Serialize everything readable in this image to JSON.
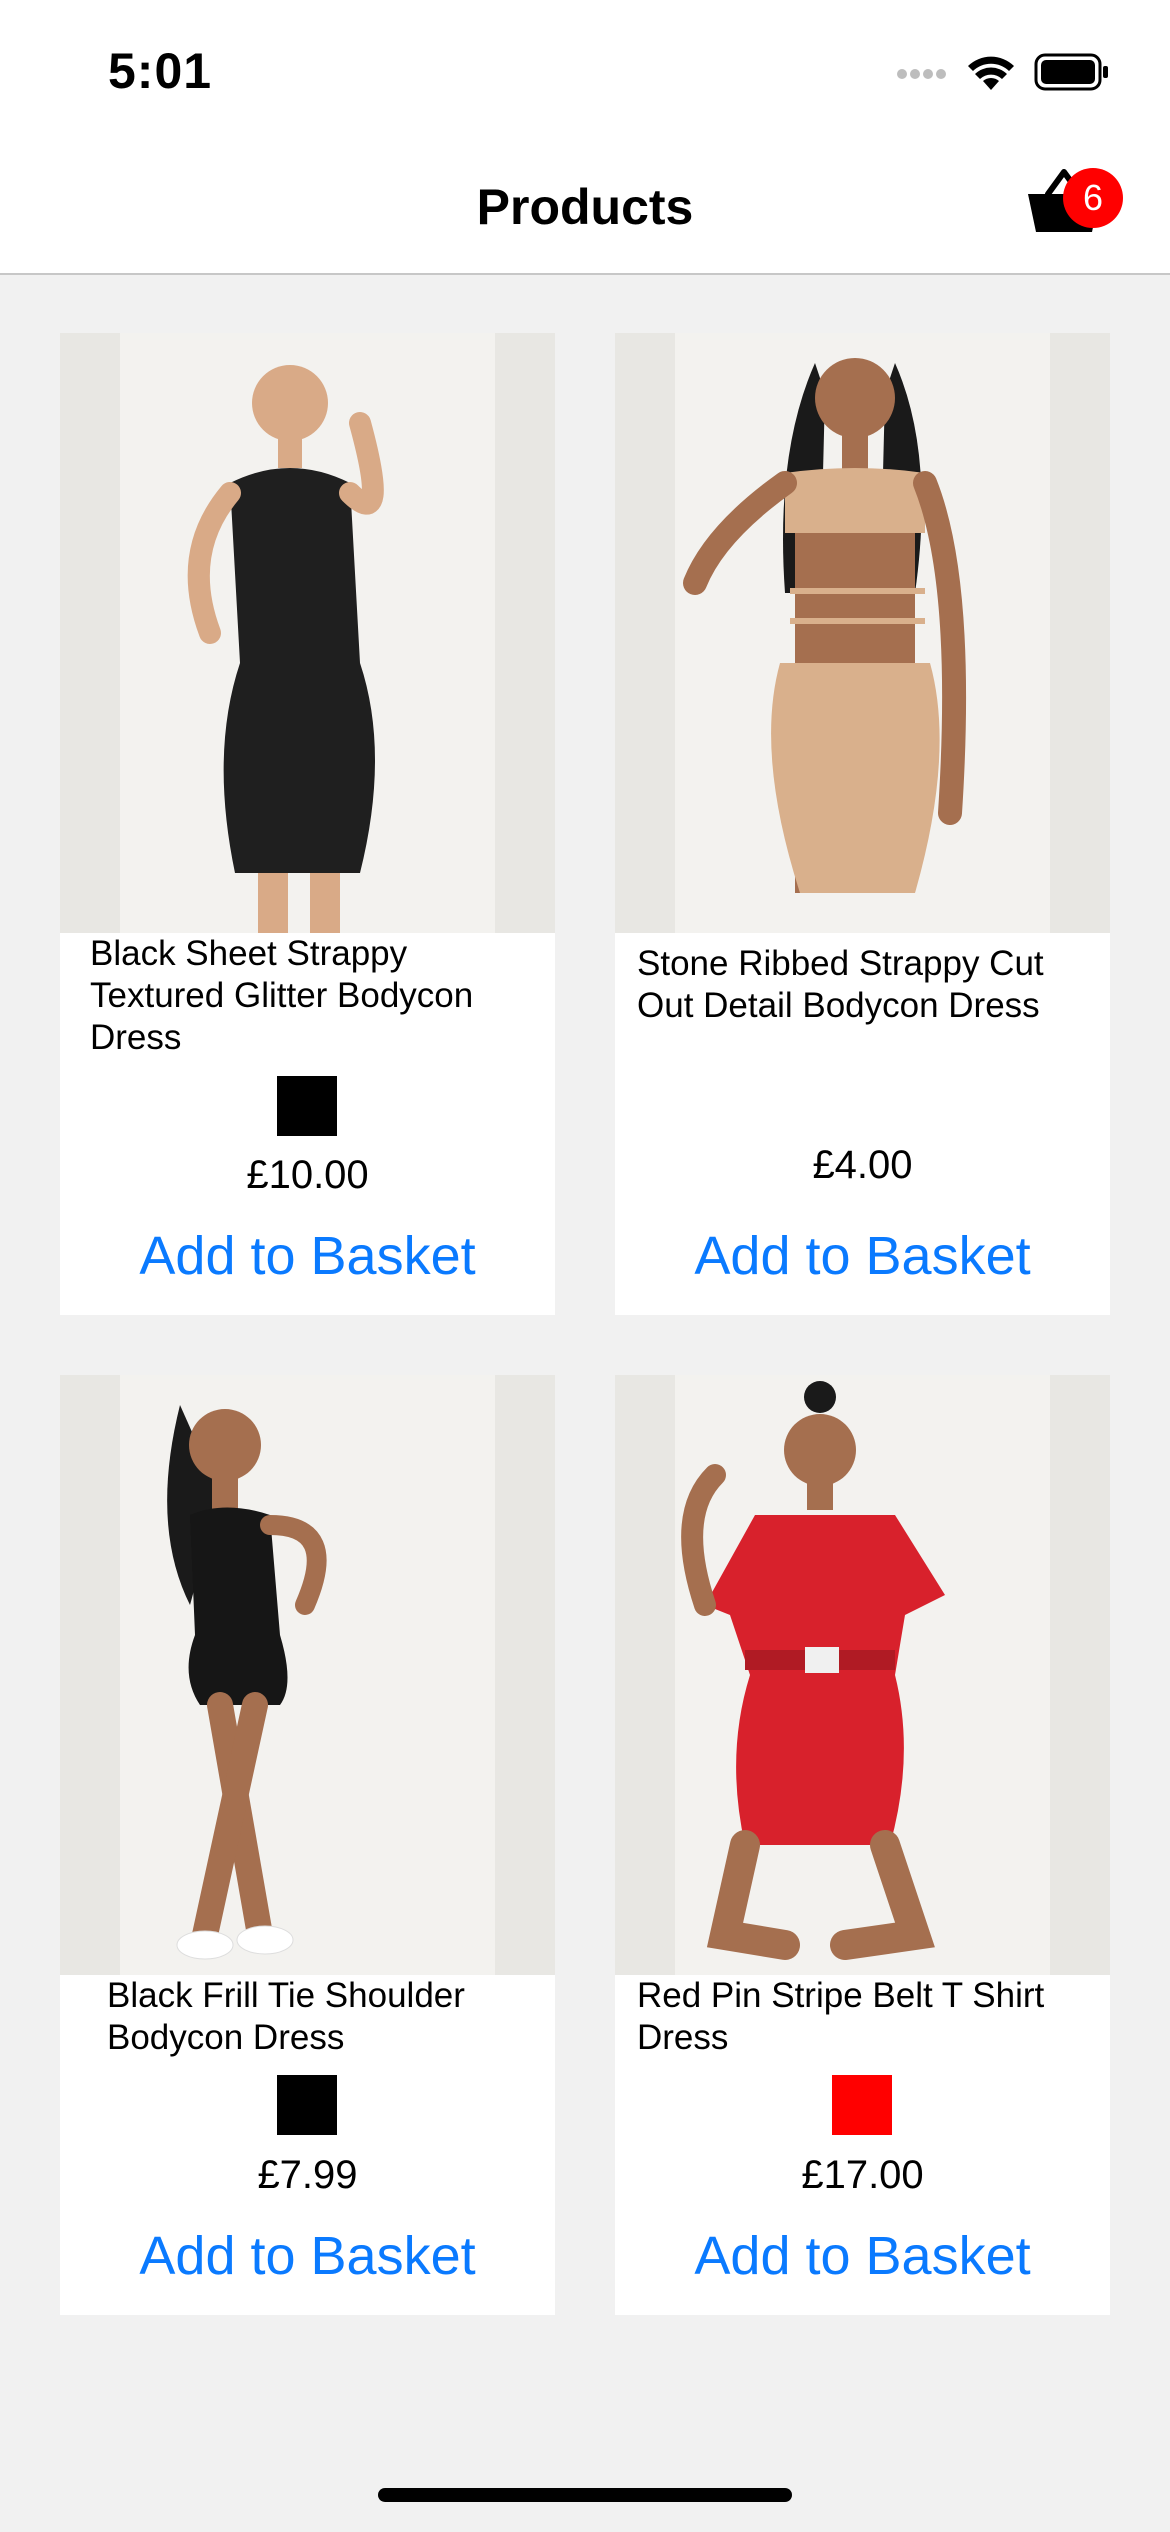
{
  "status_bar": {
    "time": "5:01"
  },
  "nav": {
    "title": "Products",
    "basket_count": "6",
    "basket_icon": "shopping-basket-icon"
  },
  "products": [
    {
      "title": "Black Sheet Strappy Textured Glitter Bodycon Dress",
      "price": "£10.00",
      "swatch_color": "#000000",
      "dress_color": "#1f1f1f",
      "add_label": "Add to Basket"
    },
    {
      "title": "Stone Ribbed Strappy Cut Out Detail Bodycon Dress",
      "price": "£4.00",
      "swatch_color": null,
      "dress_color": "#d9b08c",
      "add_label": "Add to Basket"
    },
    {
      "title": "Black Frill Tie Shoulder Bodycon Dress",
      "price": "£7.99",
      "swatch_color": "#000000",
      "dress_color": "#161616",
      "add_label": "Add to Basket"
    },
    {
      "title": "Red Pin Stripe Belt T Shirt Dress",
      "price": "£17.00",
      "swatch_color": "#ff0000",
      "dress_color": "#d8212c",
      "add_label": "Add to Basket"
    }
  ],
  "colors": {
    "accent": "#0a7aff",
    "badge": "#ff0000",
    "background": "#f1f1f1"
  }
}
